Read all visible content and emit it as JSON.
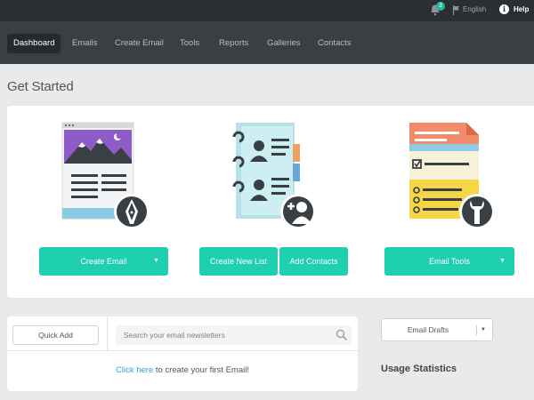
{
  "topbar": {
    "notification_count": "3",
    "language": "English",
    "help": "Help",
    "info_glyph": "i"
  },
  "nav": {
    "items": [
      {
        "label": "Dashboard",
        "active": true
      },
      {
        "label": "Emails"
      },
      {
        "label": "Create Email"
      },
      {
        "label": "Tools"
      },
      {
        "label": "Reports"
      },
      {
        "label": "Galleries"
      },
      {
        "label": "Contacts"
      }
    ]
  },
  "get_started": {
    "title": "Get Started",
    "cards": [
      {
        "icon": "email-newsletter-icon",
        "buttons": [
          {
            "label": "Create Email",
            "caret": "▼"
          }
        ]
      },
      {
        "icon": "contact-book-icon",
        "buttons": [
          {
            "label": "Create New List"
          },
          {
            "label": "Add Contacts"
          }
        ]
      },
      {
        "icon": "email-tools-icon",
        "buttons": [
          {
            "label": "Email Tools",
            "caret": "▼"
          }
        ]
      }
    ]
  },
  "emails": {
    "quick_add": "Quick Add",
    "search_placeholder": "Search your email newsletters",
    "create_link": "Click here",
    "create_text": " to create your first Email!"
  },
  "sidebar": {
    "drafts_label": "Email Drafts",
    "drafts_caret": "▼",
    "usage_title": "Usage Statistics"
  },
  "colors": {
    "accent": "#1ecfb0",
    "nav_bg": "#3a3f44",
    "topbar_bg": "#2b2f33",
    "link": "#2aa7d1"
  }
}
